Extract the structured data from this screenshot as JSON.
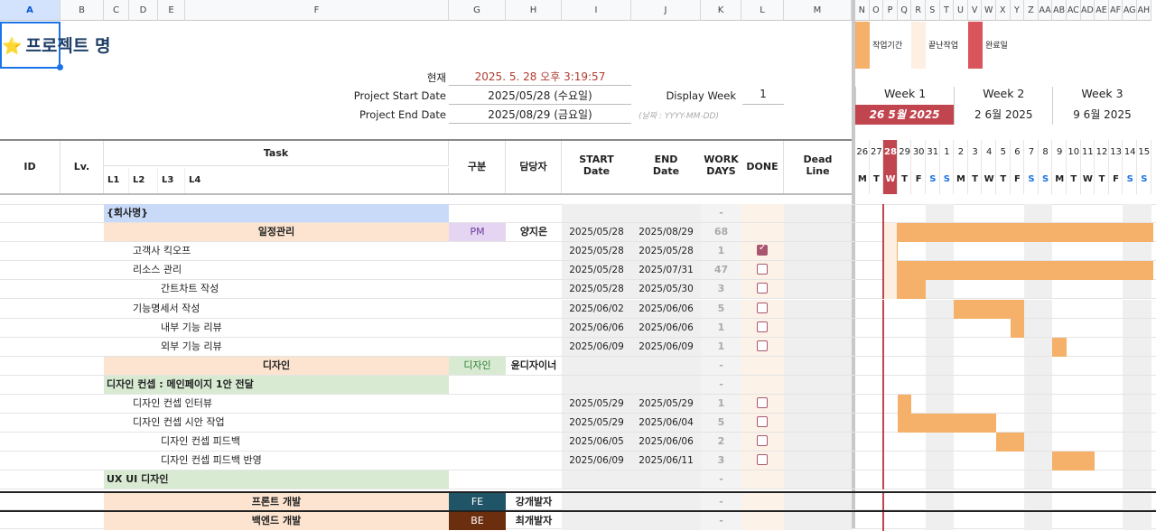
{
  "columns": {
    "left": [
      "A",
      "B",
      "C",
      "D",
      "E",
      "F",
      "G",
      "H",
      "I",
      "J",
      "K",
      "L",
      "M"
    ],
    "right": [
      "N",
      "O",
      "P",
      "Q",
      "R",
      "S",
      "T",
      "U",
      "V",
      "W",
      "X",
      "Y",
      "Z",
      "AA",
      "AB",
      "AC",
      "AD",
      "AE",
      "AF",
      "AG",
      "AH"
    ]
  },
  "project": {
    "star": "⭐",
    "title": "프로젝트 명"
  },
  "info": {
    "now_label": "현재",
    "now_value": "2025. 5. 28 오후 3:19:57",
    "start_label": "Project Start Date",
    "start_value": "2025/05/28 (수요일)",
    "end_label": "Project End Date",
    "end_value": "2025/08/29 (금요일)",
    "display_week_label": "Display Week",
    "display_week_value": "1",
    "date_hint": "(날짜 : YYYY-MM-DD)"
  },
  "legend": {
    "work": "작업기간",
    "done_work": "끝난작업",
    "complete": "완료일"
  },
  "weeks": [
    {
      "label": "Week 1",
      "date": "26 5월 2025",
      "current": true
    },
    {
      "label": "Week 2",
      "date": "2 6월 2025",
      "current": false
    },
    {
      "label": "Week 3",
      "date": "9 6월 2025",
      "current": false
    }
  ],
  "days": [
    {
      "n": "26",
      "d": "M"
    },
    {
      "n": "27",
      "d": "T"
    },
    {
      "n": "28",
      "d": "W",
      "today": true
    },
    {
      "n": "29",
      "d": "T"
    },
    {
      "n": "30",
      "d": "F"
    },
    {
      "n": "31",
      "d": "S",
      "we": true
    },
    {
      "n": "1",
      "d": "S",
      "we": true
    },
    {
      "n": "2",
      "d": "M"
    },
    {
      "n": "3",
      "d": "T"
    },
    {
      "n": "4",
      "d": "W"
    },
    {
      "n": "5",
      "d": "T"
    },
    {
      "n": "6",
      "d": "F"
    },
    {
      "n": "7",
      "d": "S",
      "we": true
    },
    {
      "n": "8",
      "d": "S",
      "we": true
    },
    {
      "n": "9",
      "d": "M"
    },
    {
      "n": "10",
      "d": "T"
    },
    {
      "n": "11",
      "d": "W"
    },
    {
      "n": "12",
      "d": "T"
    },
    {
      "n": "13",
      "d": "F"
    },
    {
      "n": "14",
      "d": "S",
      "we": true
    },
    {
      "n": "15",
      "d": "S",
      "we": true
    }
  ],
  "headers": {
    "id": "ID",
    "lv": "Lv.",
    "task": "Task",
    "l1": "L1",
    "l2": "L2",
    "l3": "L3",
    "l4": "L4",
    "type": "구분",
    "owner": "담당자",
    "start": "START\nDate",
    "end": "END\nDate",
    "workdays": "WORK\nDAYS",
    "done": "DONE",
    "deadline": "Dead\nLine"
  },
  "rows": [
    {
      "task": "{회사명}",
      "level": 1,
      "fill": "#c9daf8",
      "span": "G",
      "workdays": "-"
    },
    {
      "task": "일정관리",
      "level": 0,
      "center": true,
      "fill": "#fce4d0",
      "type": "PM",
      "type_bg": "#e6d5f2",
      "type_fg": "#6a3d9a",
      "owner": "양지은",
      "start": "2025/05/28",
      "end": "2025/08/29",
      "workdays": "68",
      "bar": [
        2,
        21
      ]
    },
    {
      "task": "고객사 킥오프",
      "level": 2,
      "start": "2025/05/28",
      "end": "2025/05/28",
      "workdays": "1",
      "done": true,
      "bar": [
        2,
        3
      ]
    },
    {
      "task": "리소스 관리",
      "level": 2,
      "start": "2025/05/28",
      "end": "2025/07/31",
      "workdays": "47",
      "done": false,
      "bar": [
        2,
        21
      ]
    },
    {
      "task": "간트차트 작성",
      "level": 3,
      "start": "2025/05/28",
      "end": "2025/05/30",
      "workdays": "3",
      "done": false,
      "bar": [
        2,
        5
      ]
    },
    {
      "task": "기능명세서 작성",
      "level": 2,
      "start": "2025/06/02",
      "end": "2025/06/06",
      "workdays": "5",
      "done": false,
      "bar": [
        7,
        12
      ]
    },
    {
      "task": "내부 기능 리뷰",
      "level": 3,
      "start": "2025/06/06",
      "end": "2025/06/06",
      "workdays": "1",
      "done": false,
      "bar": [
        11,
        12
      ]
    },
    {
      "task": "외부 기능 리뷰",
      "level": 3,
      "start": "2025/06/09",
      "end": "2025/06/09",
      "workdays": "1",
      "done": false,
      "bar": [
        14,
        15
      ]
    },
    {
      "task": "디자인",
      "level": 0,
      "center": true,
      "fill": "#fce4d0",
      "type": "디자인",
      "type_bg": "#d9ead3",
      "type_fg": "#2e7d32",
      "owner": "윤디자이너",
      "workdays": "-"
    },
    {
      "task": "디자인 컨셉 : 메인페이지 1안 전달",
      "level": 1,
      "fill": "#d9ead3",
      "span": "G",
      "workdays": "-"
    },
    {
      "task": "디자인 컨셉 인터뷰",
      "level": 2,
      "start": "2025/05/29",
      "end": "2025/05/29",
      "workdays": "1",
      "done": false,
      "bar": [
        3,
        4
      ]
    },
    {
      "task": "디자인 컨셉 시안 작업",
      "level": 2,
      "start": "2025/05/29",
      "end": "2025/06/04",
      "workdays": "5",
      "done": false,
      "bar": [
        3,
        10
      ]
    },
    {
      "task": "디자인 컨셉 피드백",
      "level": 3,
      "start": "2025/06/05",
      "end": "2025/06/06",
      "workdays": "2",
      "done": false,
      "bar": [
        10,
        12
      ]
    },
    {
      "task": "디자인 컨셉 피드백 반영",
      "level": 3,
      "start": "2025/06/09",
      "end": "2025/06/11",
      "workdays": "3",
      "done": false,
      "bar": [
        14,
        17
      ]
    },
    {
      "task": "UX UI 디자인",
      "level": 1,
      "fill": "#d9ead3",
      "span": "G",
      "workdays": "-"
    },
    {
      "task": "프론트 개발",
      "level": 0,
      "center": true,
      "fill": "#fce4d0",
      "type": "FE",
      "type_bg": "#1f5566",
      "type_fg": "#ffffff",
      "owner": "강개발자",
      "workdays": "-",
      "thick": true
    },
    {
      "task": "백엔드 개발",
      "level": 0,
      "center": true,
      "fill": "#fce4d0",
      "type": "BE",
      "type_bg": "#6b2e0e",
      "type_fg": "#ffffff",
      "owner": "최개발자",
      "workdays": "-",
      "thick": true
    }
  ]
}
